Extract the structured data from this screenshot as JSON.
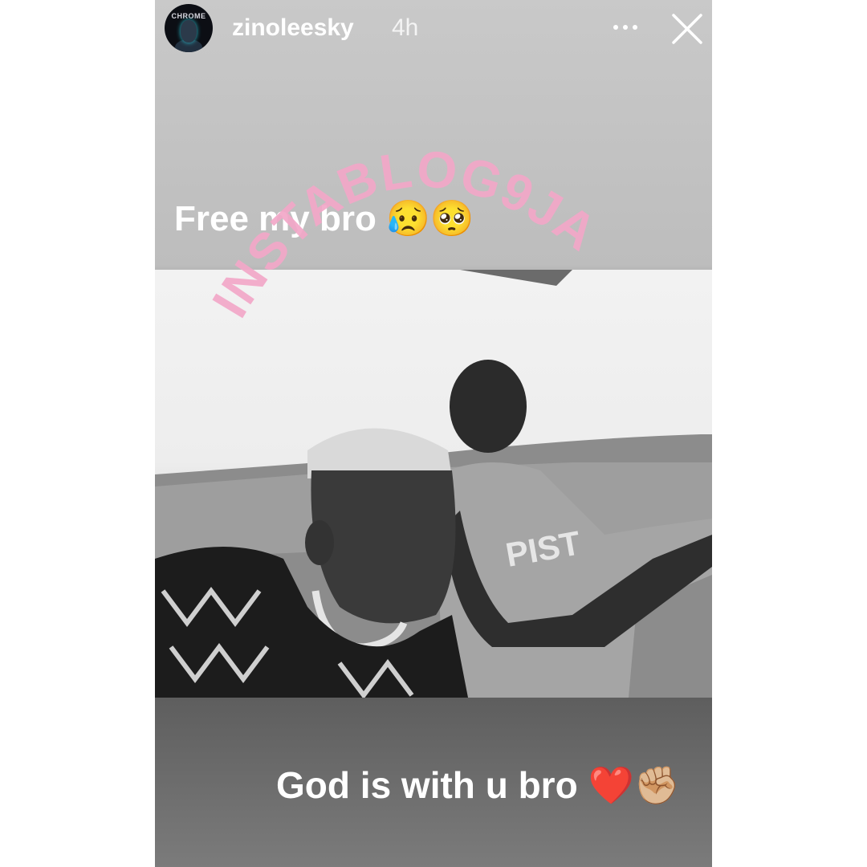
{
  "story": {
    "username": "zinoleesky",
    "time_ago": "4h",
    "avatar_label": "CHROME",
    "more_icon": "more-dots-icon",
    "close_icon": "close-icon",
    "caption_top": "Free my bro 😥🥺",
    "caption_bottom": "God is with u bro ❤️✊🏼"
  },
  "watermark": {
    "text": "INSTABLOG9JA",
    "color": "#f2a7c8"
  }
}
